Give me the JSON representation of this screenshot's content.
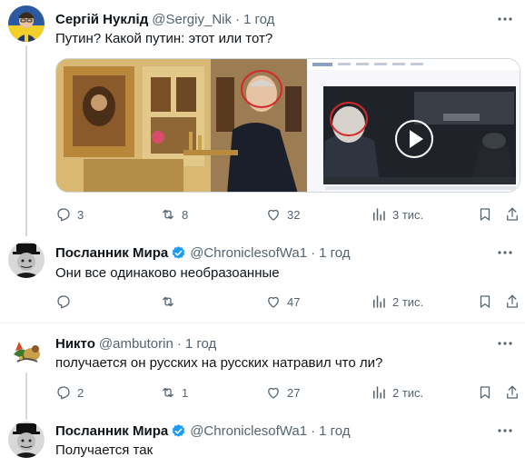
{
  "tweets": [
    {
      "name": "Сергій Нуклід",
      "handle": "@Sergiy_Nik",
      "dot": "·",
      "time": "1 год",
      "text": "Путин? Какой путин: этот или тот?",
      "replies": "3",
      "retweets": "8",
      "likes": "32",
      "views": "3 тис."
    },
    {
      "name": "Посланник Мира",
      "handle": "@ChroniclesofWa1",
      "dot": "·",
      "time": "1 год",
      "text": "Они все одинаково необразоанные",
      "replies": "",
      "retweets": "",
      "likes": "47",
      "views": "2 тис."
    },
    {
      "name": "Никто",
      "handle": "@ambutorin",
      "dot": "·",
      "time": "1 год",
      "text": "получается он русских на русских натравил что ли?",
      "replies": "2",
      "retweets": "1",
      "likes": "27",
      "views": "2 тис."
    },
    {
      "name": "Посланник Мира",
      "handle": "@ChroniclesofWa1",
      "dot": "·",
      "time": "1 год",
      "text": "Получается так"
    }
  ],
  "icons": {
    "more": "more-icon",
    "reply": "reply-icon",
    "retweet": "retweet-icon",
    "like": "heart-icon",
    "views": "views-icon",
    "bookmark": "bookmark-icon",
    "share": "share-icon",
    "verified": "verified-icon"
  },
  "colors": {
    "accent": "#1d9bf0",
    "secondary_text": "#536471",
    "thread_line": "#cfd9de"
  }
}
